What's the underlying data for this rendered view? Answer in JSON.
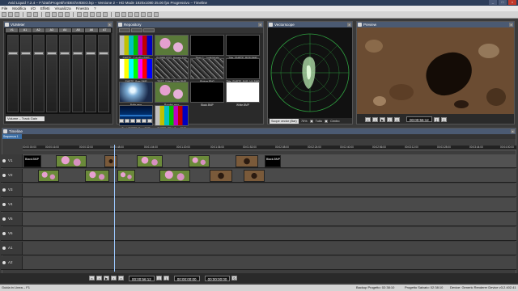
{
  "window": {
    "title": "Avid Liquid 7.2.4 – F:\\Dati\\Progetti\\VIDEO\\VIDEO.lvp – Versione 2 – HD Mode 1920x1080 25.00 fps Progressivo – Timeline"
  },
  "menu": [
    "File",
    "Modifica",
    "I/O",
    "Effetti",
    "Visualizza",
    "Finestra",
    "?"
  ],
  "vumeter": {
    "title": "VUMeter",
    "channels": [
      "V1",
      "A1",
      "A2",
      "A3",
      "A4",
      "A5",
      "A6",
      "A7"
    ],
    "mode": "Volume – Track Gain"
  },
  "repository": {
    "title": "Repository",
    "items": [
      {
        "label": "SMPTE_ColorBar.BMP",
        "kind": "bars"
      },
      {
        "label": "GLEBBUZZO_flowers.bmp",
        "kind": "flowers"
      },
      {
        "label": "Titolo 1 – Individuale",
        "kind": "textcard"
      },
      {
        "label": "Title_SMPTE_RGB.BMP",
        "kind": "textcard"
      },
      {
        "label": "SMPTE_Bars.BMP",
        "kind": "bars2"
      },
      {
        "label": "TEST_Video_Noise.BMP",
        "kind": "noise"
      },
      {
        "label": "Picture.PNG",
        "kind": "noise"
      },
      {
        "label": "Title_SMPTE_BAR_NA.BMP",
        "kind": "textcard"
      },
      {
        "label": "Bolle.mpg",
        "kind": "bubbles"
      },
      {
        "label": "Rondini.mpg",
        "kind": "flowers"
      },
      {
        "label": "Black.BMP",
        "kind": "black"
      },
      {
        "label": "White.BMP",
        "kind": "white"
      },
      {
        "label": "Tuni_SMPTE_Bars.BMP",
        "kind": "waves"
      },
      {
        "label": "SMPTE_EBU_Bars.BMP",
        "kind": "bars"
      }
    ]
  },
  "vectorscope": {
    "title": "Vectorscope",
    "scale_select": "Scope vector (Bar)",
    "zoom": "75%",
    "option_all": "Tutto",
    "option_center": "Centro"
  },
  "preview": {
    "title": "Preview",
    "timecode": "00:00:56:12"
  },
  "timeline": {
    "title": "Timeline",
    "sequence_tab": "Sequenza 1",
    "header_label": "Timeline",
    "ruler_ticks": [
      "00:00:00:00",
      "00:00:16:00",
      "00:00:32:00",
      "00:00:48:00",
      "00:01:04:00",
      "00:01:20:00",
      "00:01:36:00",
      "00:01:52:00",
      "00:02:08:00",
      "00:02:24:00",
      "00:02:40:00",
      "00:02:56:00",
      "00:03:12:00",
      "00:03:28:00",
      "00:03:44:00",
      "00:04:00:00"
    ],
    "tracks": [
      "V1",
      "V2",
      "V3",
      "V4",
      "V5",
      "V6",
      "A1",
      "A2"
    ],
    "clips_v1_label": "Black.BMP",
    "timecode": "00:00:56:12",
    "in_point": "00:00:00:00",
    "out_point": "00:00:00:00"
  },
  "status": {
    "help": "Guida in Linea – F1",
    "backup": "Backup Progetto: 02:38:10",
    "saved": "Progetto Salvato: 02:38:10",
    "device": "Device: Generic Renderer Device v3.2.402.41"
  }
}
